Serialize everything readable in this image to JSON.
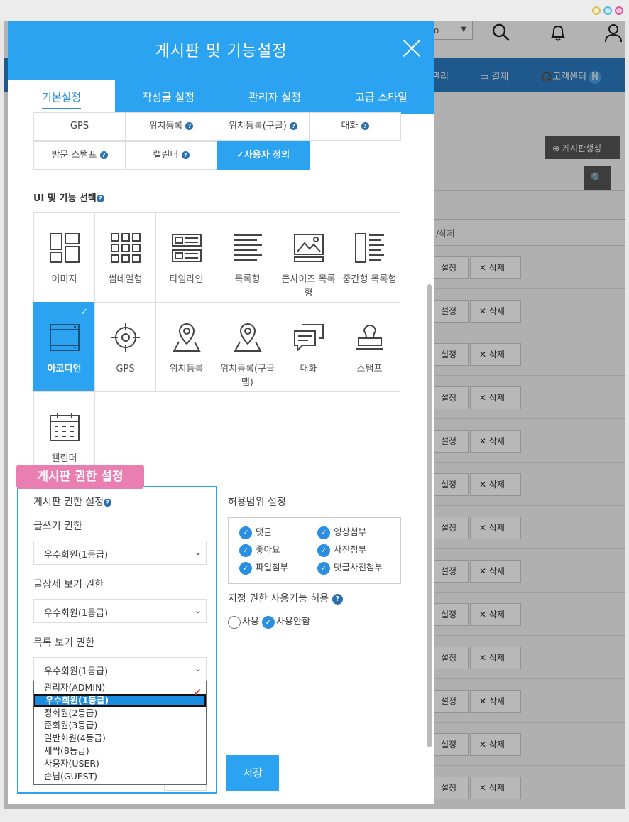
{
  "window": {
    "controls": [
      "minimize",
      "maximize",
      "close"
    ]
  },
  "background": {
    "select_value": "o",
    "nav_items": [
      {
        "label": "관리"
      },
      {
        "label": "결제"
      },
      {
        "label": "고객센터",
        "badge": "N"
      }
    ],
    "create_board_label": "게시판생성",
    "column_header": "/삭제",
    "row_buttons": {
      "edit": "설정",
      "delete": "삭제"
    },
    "row_count": 13
  },
  "modal": {
    "title": "게시판 및 기능설정",
    "tabs": [
      {
        "label": "기본설정",
        "active": true
      },
      {
        "label": "작성글 설정",
        "active": false
      },
      {
        "label": "관리자 설정",
        "active": false
      },
      {
        "label": "고급 스타일",
        "active": false
      }
    ],
    "chips_row1": [
      {
        "label": "GPS",
        "help": false
      },
      {
        "label": "위치등록",
        "help": true
      },
      {
        "label": "위치등록(구글)",
        "help": true
      },
      {
        "label": "대화",
        "help": true
      }
    ],
    "chips_row2": [
      {
        "label": "방문 스탬프",
        "help": true
      },
      {
        "label": "캘린더",
        "help": true
      },
      {
        "label": "사용자 정의",
        "selected": true
      }
    ],
    "ui_section_title": "UI 및 기능 선택",
    "ui_items": [
      {
        "label": "이미지",
        "icon": "image-layout-icon"
      },
      {
        "label": "썸네일형",
        "icon": "thumbnail-grid-icon"
      },
      {
        "label": "타임라인",
        "icon": "timeline-icon"
      },
      {
        "label": "목록형",
        "icon": "list-icon"
      },
      {
        "label": "큰사이즈 목록형",
        "icon": "large-list-icon"
      },
      {
        "label": "중간형 목록형",
        "icon": "medium-list-icon"
      },
      {
        "label": "아코디언",
        "icon": "accordion-icon",
        "selected": true
      },
      {
        "label": "GPS",
        "icon": "crosshair-icon"
      },
      {
        "label": "위치등록",
        "icon": "map-pin-icon"
      },
      {
        "label": "위치등록(구글맵)",
        "icon": "map-pin-icon"
      },
      {
        "label": "대화",
        "icon": "chat-icon"
      },
      {
        "label": "스탬프",
        "icon": "stamp-icon"
      },
      {
        "label": "캘린더",
        "icon": "calendar-icon"
      }
    ],
    "permission": {
      "badge": "게시판 권한 설정",
      "title": "게시판 권한 설정",
      "write_label": "글쓰기 권한",
      "write_value": "우수회원(1등급)",
      "view_label": "글상세 보기 권한",
      "view_value": "우수회원(1등급)",
      "list_label": "목록 보기 권한",
      "list_value": "우수회원(1등급)",
      "options": [
        "관리자(ADMIN)",
        "우수회원(1등급)",
        "정회원(2등급)",
        "준회원(3등급)",
        "일반회원(4등급)",
        "새싹(8등급)",
        "사용자(USER)",
        "손님(GUEST)"
      ],
      "highlighted_index": 1
    },
    "allow": {
      "title": "허용범위 설정",
      "items": [
        "댓글",
        "영상첨부",
        "좋아요",
        "사진첨부",
        "파일첨부",
        "댓글사진첨부"
      ],
      "designated_title": "지정 권한 사용기능 허용",
      "radio_use": "사용",
      "radio_not_use": "사용안함",
      "selected": "사용안함"
    },
    "save_label": "저장"
  },
  "colors": {
    "accent": "#2ba3f0",
    "badge_pink": "#e97fb0",
    "nav_blue": "#2b7bc0"
  }
}
